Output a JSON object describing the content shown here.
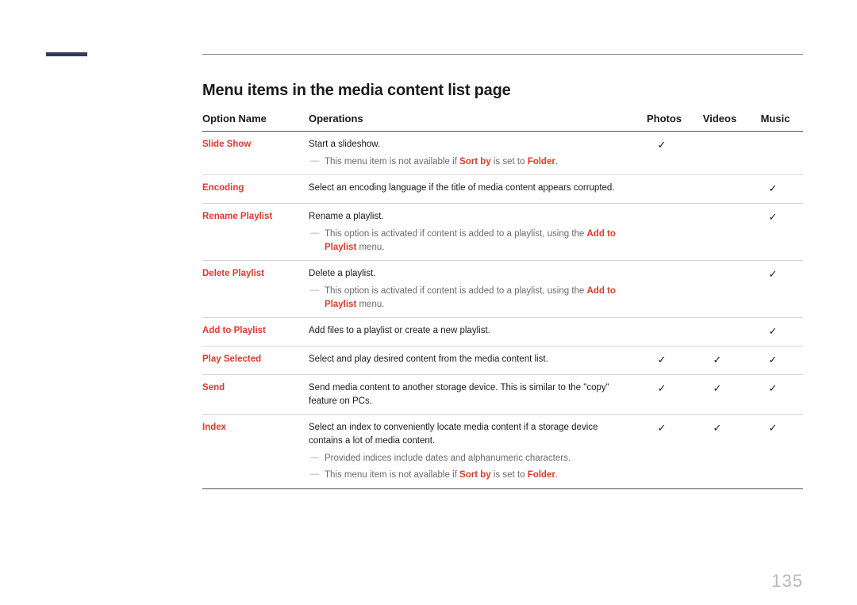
{
  "page_title": "Menu items in the media content list page",
  "page_number": "135",
  "check_glyph": "✓",
  "columns": {
    "option": "Option Name",
    "operations": "Operations",
    "photos": "Photos",
    "videos": "Videos",
    "music": "Music"
  },
  "rows": [
    {
      "name": "Slide Show",
      "operation": "Start a slideshow.",
      "notes": [
        {
          "pre": "This menu item is not available if ",
          "kw1": "Sort by",
          "mid": " is set to ",
          "kw2": "Folder",
          "post": "."
        }
      ],
      "photos": true,
      "videos": false,
      "music": false
    },
    {
      "name": "Encoding",
      "operation": "Select an encoding language if the title of media content appears corrupted.",
      "notes": [],
      "photos": false,
      "videos": false,
      "music": true
    },
    {
      "name": "Rename Playlist",
      "operation": "Rename a playlist.",
      "notes": [
        {
          "pre": "This option is activated if content is added to a playlist, using the ",
          "kw1": "Add to Playlist",
          "mid": " menu.",
          "kw2": "",
          "post": ""
        }
      ],
      "photos": false,
      "videos": false,
      "music": true
    },
    {
      "name": "Delete Playlist",
      "operation": "Delete a playlist.",
      "notes": [
        {
          "pre": "This option is activated if content is added to a playlist, using the ",
          "kw1": "Add to Playlist",
          "mid": " menu.",
          "kw2": "",
          "post": ""
        }
      ],
      "photos": false,
      "videos": false,
      "music": true
    },
    {
      "name": "Add to Playlist",
      "operation": "Add files to a playlist or create a new playlist.",
      "notes": [],
      "photos": false,
      "videos": false,
      "music": true
    },
    {
      "name": "Play Selected",
      "operation": "Select and play desired content from the media content list.",
      "notes": [],
      "photos": true,
      "videos": true,
      "music": true
    },
    {
      "name": "Send",
      "operation": "Send media content to another storage device. This is similar to the \"copy\" feature on PCs.",
      "notes": [],
      "photos": true,
      "videos": true,
      "music": true
    },
    {
      "name": "Index",
      "operation": "Select an index to conveniently locate media content if a storage device contains a lot of media content.",
      "notes": [
        {
          "pre": "Provided indices include dates and alphanumeric characters.",
          "kw1": "",
          "mid": "",
          "kw2": "",
          "post": ""
        },
        {
          "pre": "This menu item is not available if ",
          "kw1": "Sort by",
          "mid": " is set to ",
          "kw2": "Folder",
          "post": "."
        }
      ],
      "photos": true,
      "videos": true,
      "music": true
    }
  ]
}
